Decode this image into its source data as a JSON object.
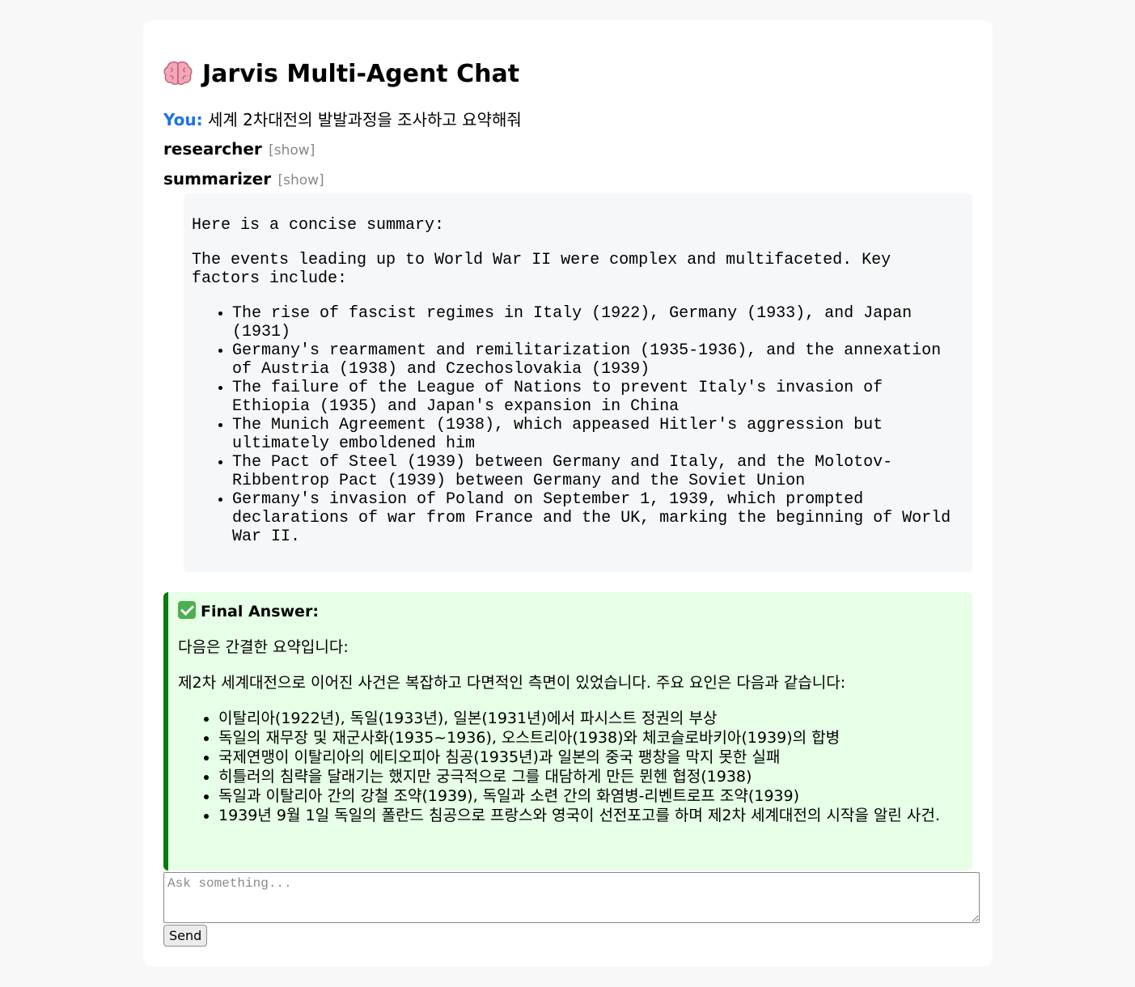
{
  "header": {
    "title_icon": "brain-emoji-icon",
    "title": "Jarvis Multi-Agent Chat"
  },
  "conversation": {
    "user_label": "You:",
    "user_message": "세계 2차대전의 발발과정을 조사하고 요약해줘",
    "agents": [
      {
        "name": "researcher",
        "toggle": "[show]"
      },
      {
        "name": "summarizer",
        "toggle": "[show]"
      }
    ],
    "summary": {
      "intro": "Here is a concise summary:",
      "lead": "The events leading up to World War II were complex and multifaceted. Key factors include:",
      "items": [
        "The rise of fascist regimes in Italy (1922), Germany (1933), and Japan (1931)",
        "Germany's rearmament and remilitarization (1935-1936), and the annexation of Austria (1938) and Czechoslovakia (1939)",
        "The failure of the League of Nations to prevent Italy's invasion of Ethiopia (1935) and Japan's expansion in China",
        "The Munich Agreement (1938), which appeased Hitler's aggression but ultimately emboldened him",
        "The Pact of Steel (1939) between Germany and Italy, and the Molotov-Ribbentrop Pact (1939) between Germany and the Soviet Union",
        "Germany's invasion of Poland on September 1, 1939, which prompted declarations of war from France and the UK, marking the beginning of World War II."
      ]
    },
    "final_answer": {
      "icon": "check-mark-emoji-icon",
      "heading": "Final Answer:",
      "intro": "다음은 간결한 요약입니다:",
      "lead": "제2차 세계대전으로 이어진 사건은 복잡하고 다면적인 측면이 있었습니다. 주요 요인은 다음과 같습니다:",
      "items": [
        "이탈리아(1922년), 독일(1933년), 일본(1931년)에서 파시스트 정권의 부상",
        "독일의 재무장 및 재군사화(1935~1936), 오스트리아(1938)와 체코슬로바키아(1939)의 합병",
        "국제연맹이 이탈리아의 에티오피아 침공(1935년)과 일본의 중국 팽창을 막지 못한 실패",
        "히틀러의 침략을 달래기는 했지만 궁극적으로 그를 대담하게 만든 뮌헨 협정(1938)",
        "독일과 이탈리아 간의 강철 조약(1939), 독일과 소련 간의 화염병-리벤트로프 조약(1939)",
        "1939년 9월 1일 독일의 폴란드 침공으로 프랑스와 영국이 선전포고를 하며 제2차 세계대전의 시작을 알린 사건."
      ]
    }
  },
  "composer": {
    "placeholder": "Ask something...",
    "value": "",
    "send_label": "Send"
  },
  "colors": {
    "page_background": "#f8f8f8",
    "card_background": "#ffffff",
    "user_label": "#1a73e8",
    "toggle_text": "#888888",
    "summary_background": "#f6f7f9",
    "final_background": "#e6ffe6",
    "final_border": "#0a7a0a"
  }
}
